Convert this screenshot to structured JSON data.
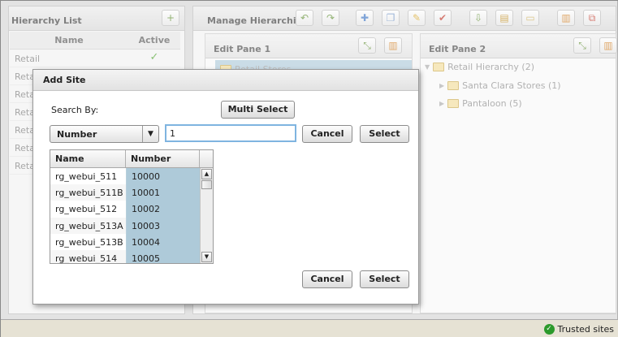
{
  "hierarchy_list": {
    "title": "Hierarchy List",
    "col_name": "Name",
    "col_active": "Active",
    "rows": [
      {
        "name": "Retail",
        "active": "✓"
      },
      {
        "name": "Retail",
        "active": "✓"
      },
      {
        "name": "Retail",
        "active": ""
      },
      {
        "name": "Retail",
        "active": ""
      },
      {
        "name": "Retail",
        "active": ""
      },
      {
        "name": "Retail",
        "active": ""
      },
      {
        "name": "Retail",
        "active": ""
      }
    ]
  },
  "manage": {
    "title": "Manage Hierarchies"
  },
  "edit_pane_1": {
    "title": "Edit Pane 1",
    "selected_item": "Retail Stores"
  },
  "edit_pane_2": {
    "title": "Edit Pane 2",
    "root": "Retail Hierarchy (2)",
    "children": [
      "Santa Clara Stores (1)",
      "Pantaloon (5)"
    ]
  },
  "dialog": {
    "title": "Add Site",
    "search_by_label": "Search By:",
    "multi_select": "Multi Select",
    "search_field": "Number",
    "search_value": "1",
    "cancel": "Cancel",
    "select": "Select",
    "grid": {
      "col_name": "Name",
      "col_number": "Number",
      "rows": [
        {
          "name": "rg_webui_511",
          "number": "10000"
        },
        {
          "name": "rg_webui_511B",
          "number": "10001"
        },
        {
          "name": "rg_webui_512",
          "number": "10002"
        },
        {
          "name": "rg_webui_513A",
          "number": "10003"
        },
        {
          "name": "rg_webui_513B",
          "number": "10004"
        },
        {
          "name": "rg_webui_514",
          "number": "10005"
        }
      ]
    },
    "bottom_cancel": "Cancel",
    "bottom_select": "Select"
  },
  "statusbar": {
    "zone": "Trusted sites"
  }
}
